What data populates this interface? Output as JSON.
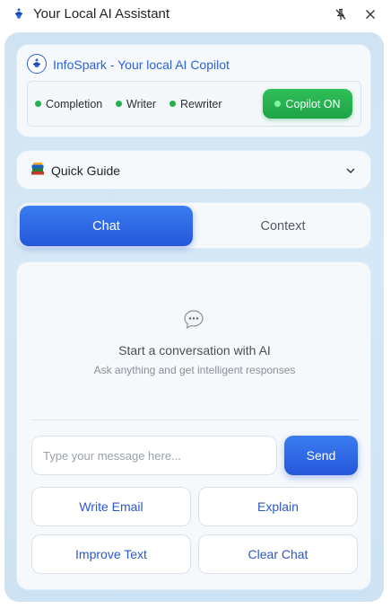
{
  "window": {
    "title": "Your Local AI Assistant",
    "icons": {
      "app": "app-logo-icon",
      "pin": "unpin-icon",
      "close": "close-icon"
    }
  },
  "brand": {
    "name": "InfoSpark - Your local AI Copilot",
    "features": [
      "Completion",
      "Writer",
      "Rewriter"
    ],
    "copilot_label": "Copilot ON",
    "colors": {
      "accent": "#2b62d9",
      "status_green": "#22b14c"
    }
  },
  "guide": {
    "label": "Quick Guide",
    "icon": "books-icon"
  },
  "tabs": [
    {
      "label": "Chat",
      "active": true
    },
    {
      "label": "Context",
      "active": false
    }
  ],
  "chat": {
    "empty_title": "Start a conversation with AI",
    "empty_subtitle": "Ask anything and get intelligent responses",
    "input_placeholder": "Type your message here...",
    "input_value": "",
    "send_label": "Send",
    "quick_actions": [
      "Write Email",
      "Explain",
      "Improve Text",
      "Clear Chat"
    ]
  }
}
